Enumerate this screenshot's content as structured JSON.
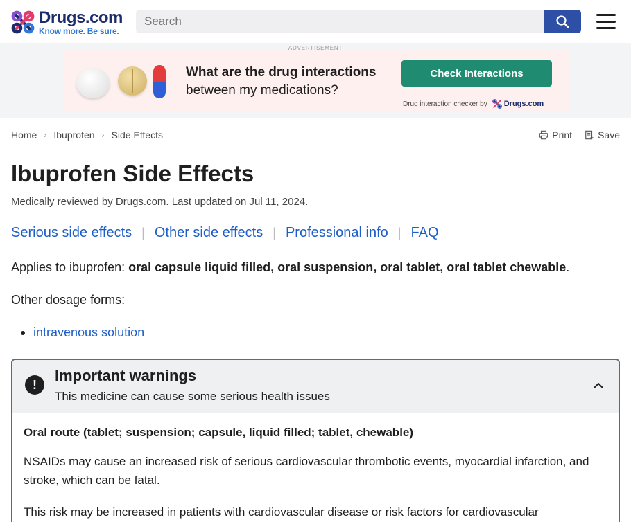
{
  "header": {
    "logo_name": "Drugs.com",
    "logo_tagline": "Know more. Be sure.",
    "search_placeholder": "Search",
    "icons": {
      "search": "search-icon",
      "menu": "hamburger-menu-icon"
    },
    "colors": {
      "brand_navy": "#1c2b6b",
      "brand_blue": "#2f78d6",
      "search_button": "#2d4fa6"
    }
  },
  "ad": {
    "label": "ADVERTISEMENT",
    "headline": "What are the drug interactions",
    "subline": "between my medications?",
    "cta": "Check Interactions",
    "credit": "Drug interaction checker by",
    "credit_brand": "Drugs.com",
    "colors": {
      "background": "#fdf0ee",
      "cta": "#1f8c72"
    }
  },
  "breadcrumb": {
    "items": [
      "Home",
      "Ibuprofen",
      "Side Effects"
    ]
  },
  "actions": {
    "print": "Print",
    "save": "Save"
  },
  "page": {
    "title": "Ibuprofen Side Effects",
    "reviewed_link": "Medically reviewed",
    "reviewed_rest": " by Drugs.com. Last updated on Jul 11, 2024."
  },
  "tabs": [
    "Serious side effects",
    "Other side effects",
    "Professional info",
    "FAQ"
  ],
  "applies": {
    "prefix": "Applies to ibuprofen: ",
    "forms": "oral capsule liquid filled, oral suspension, oral tablet, oral tablet chewable",
    "suffix": "."
  },
  "other_forms": {
    "label": "Other dosage forms:",
    "items": [
      "intravenous solution"
    ]
  },
  "warning": {
    "title": "Important warnings",
    "subtitle": "This medicine can cause some serious health issues",
    "route": "Oral route (tablet; suspension; capsule, liquid filled; tablet, chewable)",
    "paragraph1": "NSAIDs may cause an increased risk of serious cardiovascular thrombotic events, myocardial infarction, and stroke, which can be fatal.",
    "paragraph2": "This risk may be increased in patients with cardiovascular disease or risk factors for cardiovascular",
    "expanded": true
  },
  "link_color": "#1d5ec7"
}
